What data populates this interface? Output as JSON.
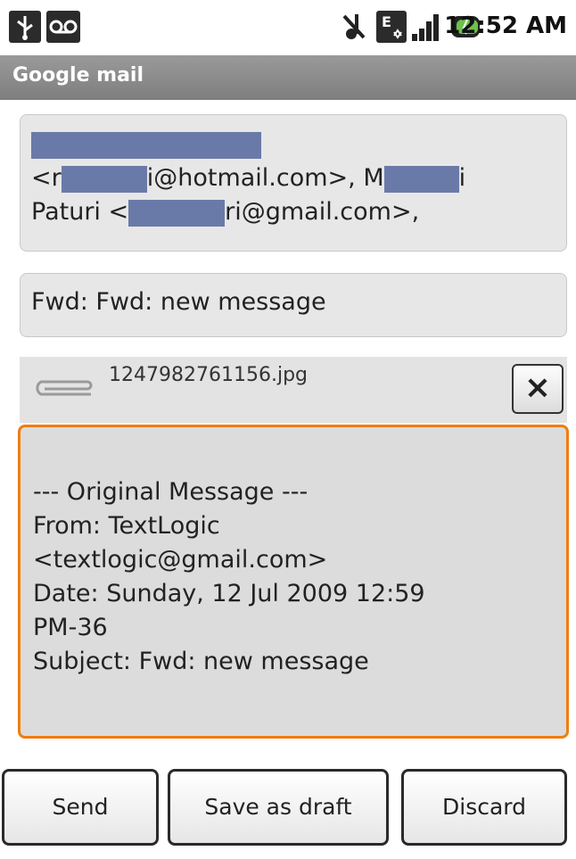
{
  "status_bar": {
    "time": "12:52 AM",
    "icons": [
      "usb-icon",
      "voicemail-icon",
      "mute-icon",
      "data-icon",
      "signal-icon",
      "battery-icon"
    ]
  },
  "app": {
    "title": "Google mail"
  },
  "compose": {
    "to_lines": [
      {
        "prefix": "<r",
        "suffix": "i@hotmail.com>, M",
        "tail": "i"
      },
      {
        "prefix": "Paturi <",
        "suffix": "ri@gmail.com>,"
      }
    ],
    "subject": "Fwd: Fwd: new message",
    "attachment": {
      "filename": "1247982761156.jpg",
      "remove_label": "×"
    },
    "body_lines": [
      "--- Original Message ---",
      "From: TextLogic",
      "<textlogic@gmail.com>",
      "Date: Sunday, 12 Jul 2009 12:59",
      "PM-36",
      "Subject: Fwd: new message"
    ]
  },
  "buttons": {
    "send": "Send",
    "save_draft": "Save as draft",
    "discard": "Discard"
  },
  "colors": {
    "focus_border": "#f07d10",
    "title_bar": "#8a8a8a",
    "redaction": "#6a7aa8"
  }
}
